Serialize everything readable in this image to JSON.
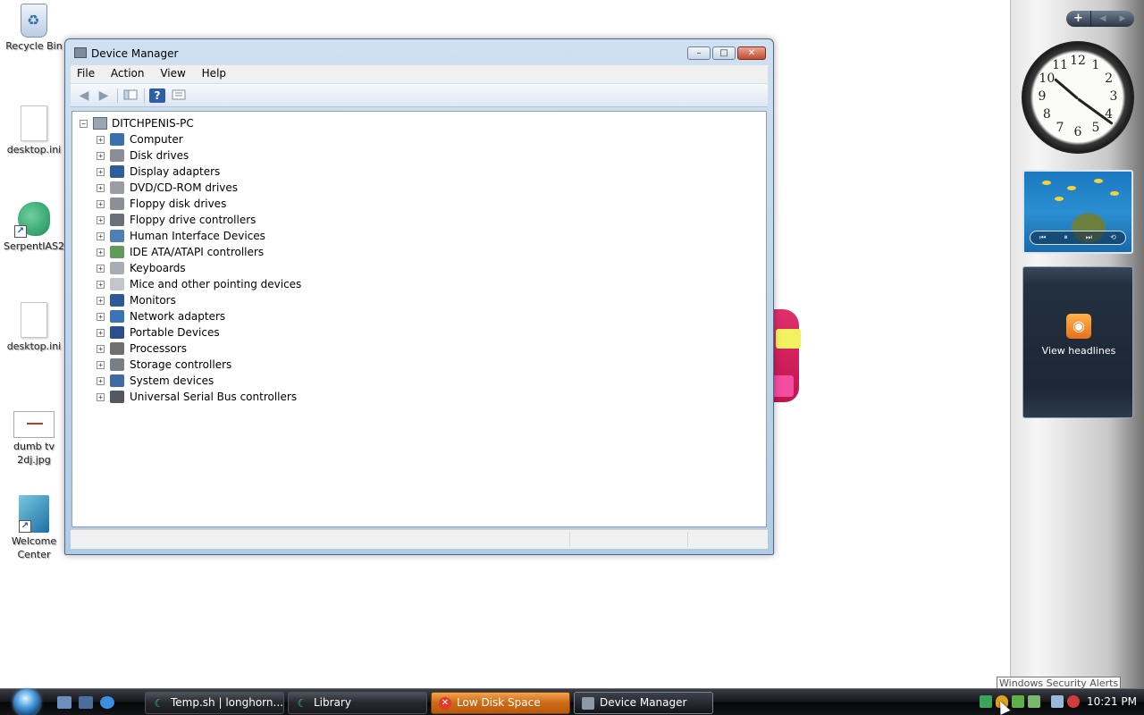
{
  "desktop": {
    "icons": [
      {
        "label": "Recycle Bin",
        "icon": "recycle-bin-icon"
      },
      {
        "label": "desktop.ini",
        "icon": "file-icon"
      },
      {
        "label": "SerpentIAS2",
        "icon": "serpent-app-icon"
      },
      {
        "label": "desktop.ini",
        "icon": "file-icon"
      },
      {
        "label": "dumb tv 2dj.jpg",
        "icon": "image-thumbnail-icon"
      },
      {
        "label": "Welcome Center",
        "icon": "welcome-center-icon"
      }
    ]
  },
  "window": {
    "title": "Device Manager",
    "buttons": {
      "minimize": "–",
      "maximize": "□",
      "close": "✕"
    },
    "menu": [
      "File",
      "Action",
      "View",
      "Help"
    ],
    "toolbar": {
      "back": "◀",
      "forward": "▶",
      "help": "?"
    },
    "tree": {
      "root": "DITCHPENIS-PC",
      "expand_symbol": "+",
      "collapse_symbol": "−",
      "items": [
        {
          "label": "Computer",
          "color": "#3a6fb0"
        },
        {
          "label": "Disk drives",
          "color": "#8b8f95"
        },
        {
          "label": "Display adapters",
          "color": "#2f5e9e"
        },
        {
          "label": "DVD/CD-ROM drives",
          "color": "#9a9ea4"
        },
        {
          "label": "Floppy disk drives",
          "color": "#8c9096"
        },
        {
          "label": "Floppy drive controllers",
          "color": "#6b7078"
        },
        {
          "label": "Human Interface Devices",
          "color": "#4f7fb8"
        },
        {
          "label": "IDE ATA/ATAPI controllers",
          "color": "#5f9c5a"
        },
        {
          "label": "Keyboards",
          "color": "#a9adb3"
        },
        {
          "label": "Mice and other pointing devices",
          "color": "#c3c6ca"
        },
        {
          "label": "Monitors",
          "color": "#2d5899"
        },
        {
          "label": "Network adapters",
          "color": "#3a73b8"
        },
        {
          "label": "Portable Devices",
          "color": "#2b4f8a"
        },
        {
          "label": "Processors",
          "color": "#6f6f6f"
        },
        {
          "label": "Storage controllers",
          "color": "#7a7f86"
        },
        {
          "label": "System devices",
          "color": "#3f6aa6"
        },
        {
          "label": "Universal Serial Bus controllers",
          "color": "#55595f"
        }
      ]
    }
  },
  "sidebar": {
    "add_gadget": "+",
    "prev": "◀",
    "next": "▶",
    "clock_numbers": [
      "12",
      "1",
      "2",
      "3",
      "4",
      "5",
      "6",
      "7",
      "8",
      "9",
      "10",
      "11"
    ],
    "slideshow_controls": [
      "⏮",
      "⏸",
      "⏭",
      "⟲"
    ],
    "feed_label": "View headlines"
  },
  "taskbar": {
    "tasks": [
      {
        "label": "Temp.sh | longhorn...",
        "state": "normal"
      },
      {
        "label": "Library",
        "state": "normal"
      },
      {
        "label": "Low Disk Space",
        "state": "alert"
      },
      {
        "label": "Device Manager",
        "state": "active"
      }
    ],
    "clock": "10:21 PM",
    "tooltip": "Windows Security Alerts"
  }
}
